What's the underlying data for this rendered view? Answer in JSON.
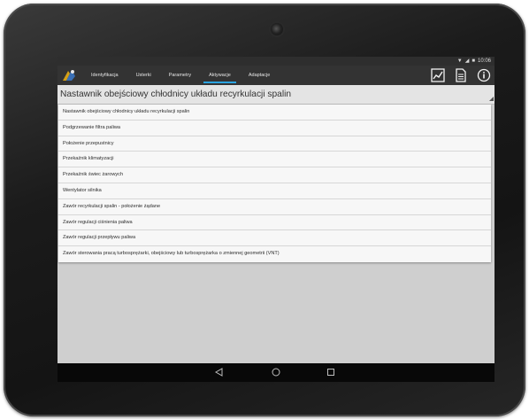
{
  "status": {
    "time": "10:06"
  },
  "tabs": [
    {
      "label": "Identyfikacja",
      "active": false
    },
    {
      "label": "Usterki",
      "active": false
    },
    {
      "label": "Parametry",
      "active": false
    },
    {
      "label": "Aktywacje",
      "active": true
    },
    {
      "label": "Adaptacje",
      "active": false
    }
  ],
  "title": "Nastawnik obejściowy chłodnicy układu recyrkulacji spalin",
  "items": [
    "Nastawnik obejściowy chłodnicy układu recyrkulacji spalin",
    "Podgrzewanie filtra paliwa",
    "Położenie przepustnicy",
    "Przekaźnik klimatyzacji",
    "Przekaźnik świec żarowych",
    "Wentylator silnika",
    "Zawór recyrkulacji spalin - położenie żądane",
    "Zawór regulacji ciśnienia paliwa",
    "Zawór regulacji przepływu paliwa",
    "Zawór sterowania pracą turbosprężarki, obejściowy lub turbosprężarka o zmiennej geometrii (VNT)"
  ],
  "icons": {
    "logo": "app-logo-icon",
    "chart": "line-chart-icon",
    "report": "document-icon",
    "info": "info-icon",
    "back": "back-triangle-icon",
    "home": "home-circle-icon",
    "recents": "recents-square-icon"
  },
  "colors": {
    "accent": "#2aa3e0",
    "topbar": "#333333",
    "screen_bg": "#cfcfcf"
  }
}
